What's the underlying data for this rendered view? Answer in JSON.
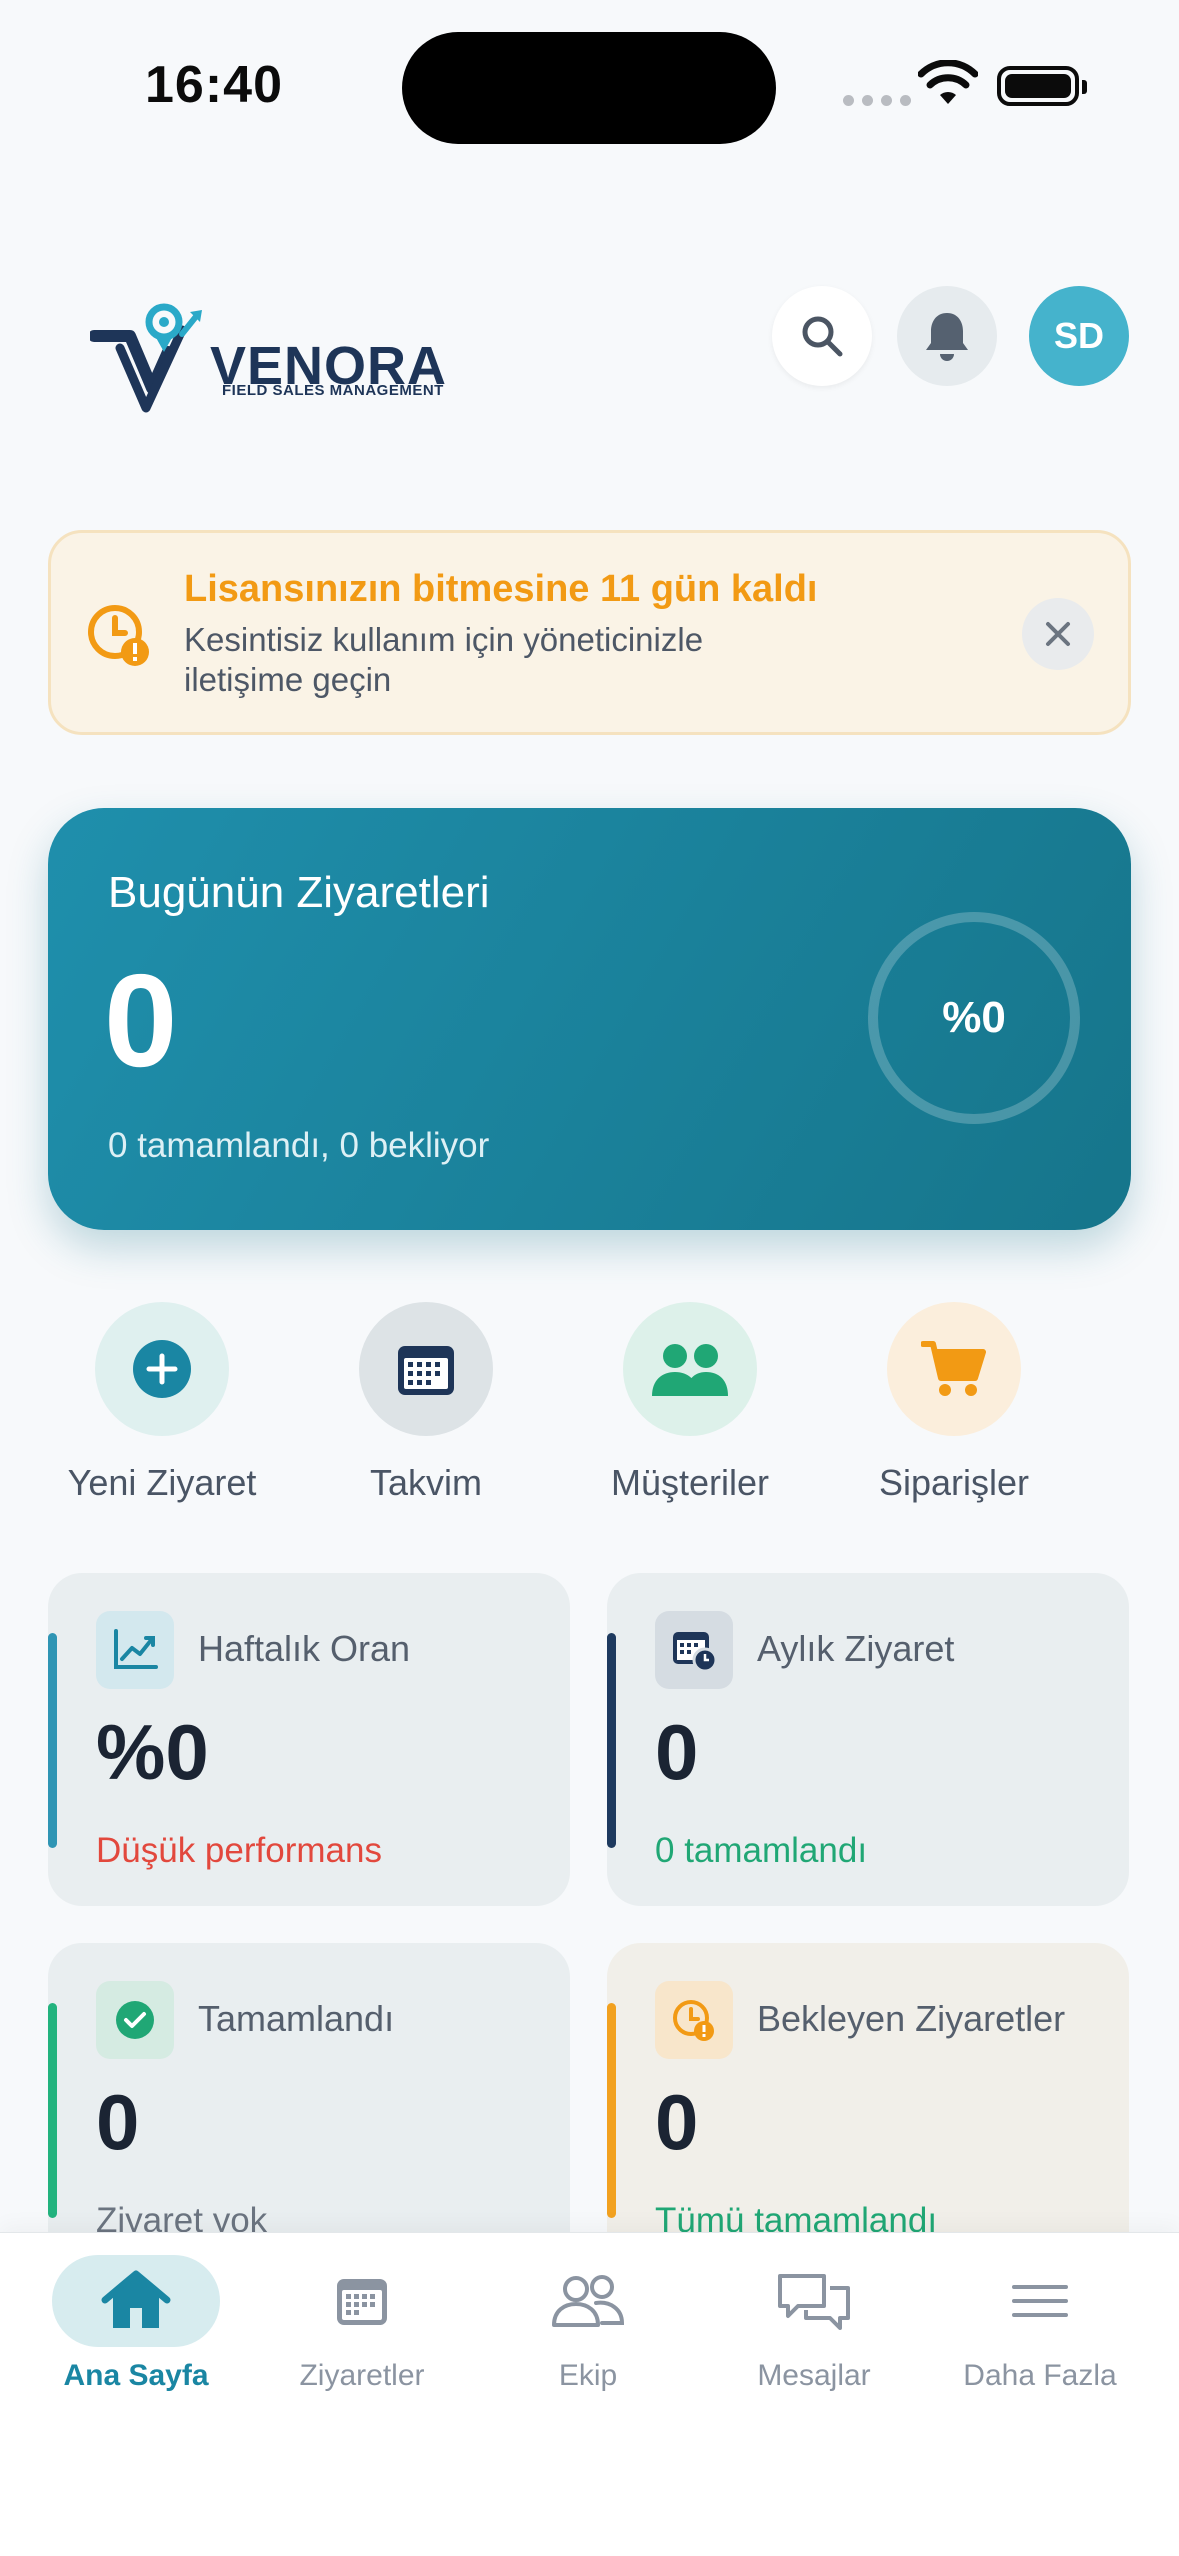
{
  "status_bar": {
    "time": "16:40"
  },
  "header": {
    "logo": {
      "name": "VENORA",
      "tagline": "FIELD SALES MANAGEMENT"
    },
    "avatar_initials": "SD",
    "icons": [
      "search-icon",
      "bell-icon"
    ]
  },
  "license_banner": {
    "title": "Lisansınızın bitmesine 11 gün kaldı",
    "message": "Kesintisiz kullanım için yöneticinizle iletişime geçin",
    "icon": "clock-warning-icon"
  },
  "today_visits": {
    "title": "Bugünün Ziyaretleri",
    "count": "0",
    "summary": "0 tamamlandı, 0 bekliyor",
    "percent_label": "%0",
    "progress_fraction": 0
  },
  "quick_actions": [
    {
      "label": "Yeni Ziyaret",
      "icon": "plus-circle-icon"
    },
    {
      "label": "Takvim",
      "icon": "calendar-icon"
    },
    {
      "label": "Müşteriler",
      "icon": "users-icon"
    },
    {
      "label": "Siparişler",
      "icon": "cart-icon"
    }
  ],
  "stats": [
    {
      "label": "Haftalık Oran",
      "value": "%0",
      "footer": "Düşük performans",
      "footer_color": "#e2483d",
      "accent": "#2f95b4",
      "icon": "chart-line-icon"
    },
    {
      "label": "Aylık Ziyaret",
      "value": "0",
      "footer": "0 tamamlandı",
      "footer_color": "#20a775",
      "accent": "#1e3a5f",
      "icon": "calendar-clock-icon"
    },
    {
      "label": "Tamamlandı",
      "value": "0",
      "footer": "Ziyaret yok",
      "footer_color": "#6b7480",
      "accent": "#22b37e",
      "icon": "check-circle-icon"
    },
    {
      "label": "Bekleyen Ziyaretler",
      "value": "0",
      "footer": "Tümü tamamlandı",
      "footer_color": "#20a775",
      "accent": "#f2a11f",
      "icon": "clock-alert-icon"
    }
  ],
  "bottom_nav": [
    {
      "label": "Ana Sayfa",
      "icon": "home-icon",
      "active": true
    },
    {
      "label": "Ziyaretler",
      "icon": "calendar-icon",
      "active": false
    },
    {
      "label": "Ekip",
      "icon": "team-icon",
      "active": false
    },
    {
      "label": "Mesajlar",
      "icon": "chat-icon",
      "active": false
    },
    {
      "label": "Daha Fazla",
      "icon": "menu-icon",
      "active": false
    }
  ],
  "colors": {
    "brand": "#1a86a3",
    "hero_gradient": [
      "#1f8fac",
      "#16758b"
    ],
    "warning": "#f29a14",
    "danger": "#e2483d",
    "success": "#20a775"
  }
}
